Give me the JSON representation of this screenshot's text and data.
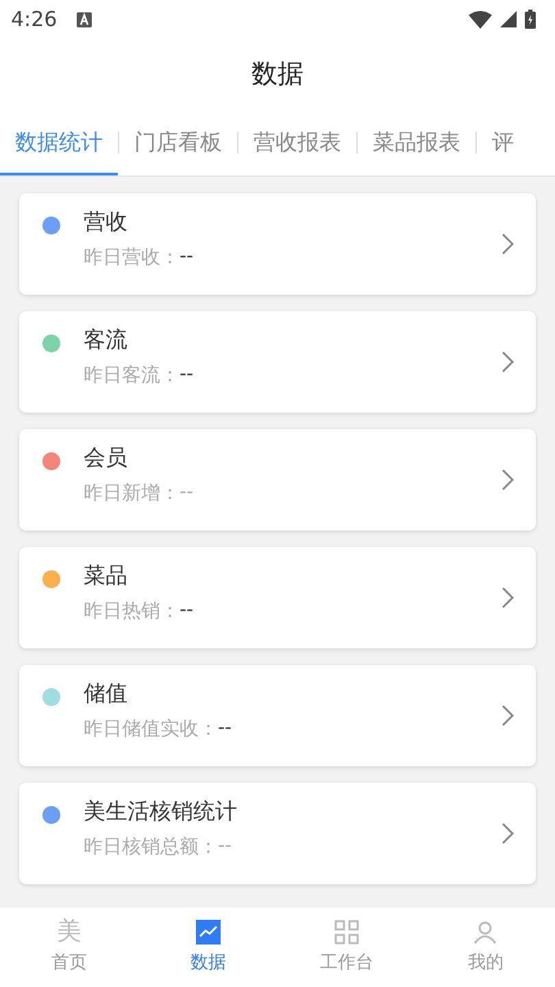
{
  "status_bar": {
    "time": "4:26"
  },
  "header": {
    "title": "数据"
  },
  "tabs": [
    {
      "label": "数据统计",
      "selected": true
    },
    {
      "label": "门店看板",
      "selected": false
    },
    {
      "label": "营收报表",
      "selected": false
    },
    {
      "label": "菜品报表",
      "selected": false
    },
    {
      "label": "评",
      "selected": false
    }
  ],
  "cards": [
    {
      "title": "营收",
      "color": "#6b9ef5",
      "label": "昨日营收：",
      "value": "--",
      "dim": false
    },
    {
      "title": "客流",
      "color": "#7dd3a8",
      "label": "昨日客流：",
      "value": "--",
      "dim": false
    },
    {
      "title": "会员",
      "color": "#f5857a",
      "label": "昨日新增：",
      "value": "--",
      "dim": true
    },
    {
      "title": "菜品",
      "color": "#fbb04c",
      "label": "昨日热销：",
      "value": "--",
      "dim": false
    },
    {
      "title": "储值",
      "color": "#9fdde0",
      "label": "昨日储值实收：",
      "value": "--",
      "dim": false
    },
    {
      "title": "美生活核销统计",
      "color": "#6b9ef5",
      "label": "昨日核销总额：",
      "value": "--",
      "dim": true
    }
  ],
  "bottom_nav": [
    {
      "kind": "glyph",
      "glyph": "美",
      "label": "首页",
      "selected": false
    },
    {
      "kind": "chart",
      "label": "数据",
      "selected": true
    },
    {
      "kind": "grid",
      "label": "工作台",
      "selected": false
    },
    {
      "kind": "person",
      "label": "我的",
      "selected": false
    }
  ]
}
